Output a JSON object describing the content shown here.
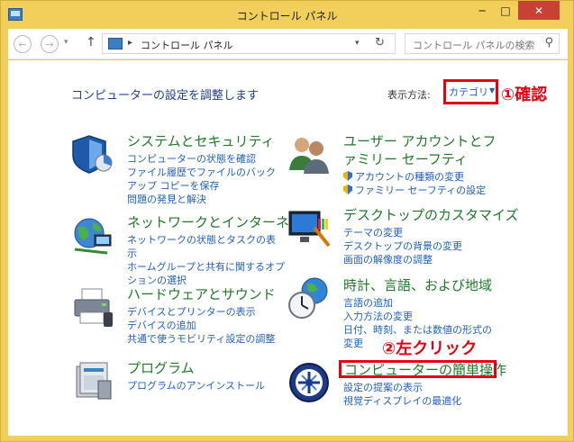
{
  "window": {
    "title": "コントロール パネル",
    "min_label": "─",
    "max_label": "□",
    "close_label": "✕"
  },
  "nav": {
    "back": "←",
    "forward": "→",
    "dropdown": "▾",
    "up": "↑",
    "address_sep": "▸",
    "address": "コントロール パネル",
    "address_drop": "▾",
    "refresh": "↻",
    "search_placeholder": "コントロール パネルの検索",
    "search_glyph": "⚲"
  },
  "main": {
    "heading": "コンピューターの設定を調整します",
    "view_label": "表示方法:",
    "view_value": "カテゴリ",
    "view_arrow": "▼"
  },
  "annotations": {
    "step1": "①確認",
    "step2": "②左クリック"
  },
  "categories": {
    "system": {
      "title": "システムとセキュリティ",
      "links": [
        "コンピューターの状態を確認",
        "ファイル履歴でファイルのバックアップ コピーを保存",
        "問題の発見と解決"
      ]
    },
    "network": {
      "title": "ネットワークとインターネット",
      "links": [
        "ネットワークの状態とタスクの表示",
        "ホームグループと共有に関するオプションの選択"
      ]
    },
    "hardware": {
      "title": "ハードウェアとサウンド",
      "links": [
        "デバイスとプリンターの表示",
        "デバイスの追加",
        "共通で使うモビリティ設定の調整"
      ]
    },
    "programs": {
      "title": "プログラム",
      "links": [
        "プログラムのアンインストール"
      ]
    },
    "users": {
      "title": "ユーザー アカウントとファミリー セーフティ",
      "links": [
        "アカウントの種類の変更",
        "ファミリー セーフティの設定"
      ]
    },
    "desktop": {
      "title": "デスクトップのカスタマイズ",
      "links": [
        "テーマの変更",
        "デスクトップの背景の変更",
        "画面の解像度の調整"
      ]
    },
    "clock": {
      "title": "時計、言語、および地域",
      "links": [
        "言語の追加",
        "入力方法の変更",
        "日付、時刻、または数値の形式の変更"
      ]
    },
    "ease": {
      "title": "コンピューターの簡単操作",
      "links": [
        "設定の提案の表示",
        "視覚ディスプレイの最適化"
      ]
    }
  },
  "colors": {
    "accent_red": "#e60012",
    "link_blue": "#1f5fbf",
    "category_green": "#1d7a28",
    "heading_blue": "#1e3f8f",
    "frame_yellow": "#f2cf5b"
  },
  "icons": {
    "system": "shield-chart-icon",
    "network": "globe-network-icon",
    "hardware": "printer-icon",
    "programs": "program-box-icon",
    "users": "users-icon",
    "desktop": "monitor-palette-icon",
    "clock": "clock-globe-icon",
    "ease": "ease-of-access-icon"
  }
}
